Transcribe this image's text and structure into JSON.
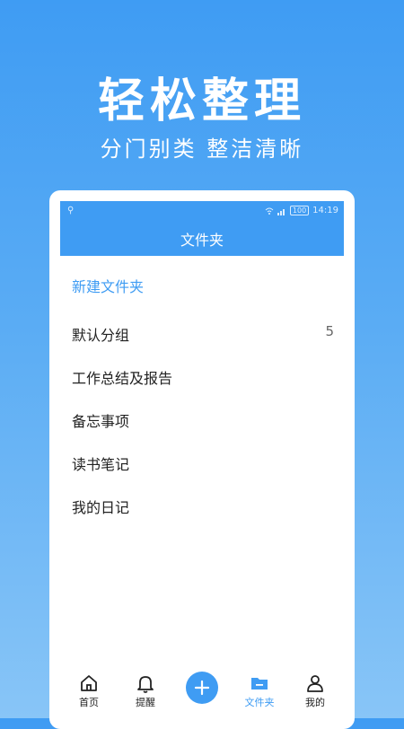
{
  "banner": {
    "headline": "轻松整理",
    "subline": "分门别类 整洁清晰"
  },
  "statusbar": {
    "battery": "100",
    "time": "14:19"
  },
  "header": {
    "title": "文件夹"
  },
  "new_folder_label": "新建文件夹",
  "folders": [
    {
      "name": "默认分组",
      "count": "5"
    },
    {
      "name": "工作总结及报告",
      "count": ""
    },
    {
      "name": "备忘事项",
      "count": ""
    },
    {
      "name": "读书笔记",
      "count": ""
    },
    {
      "name": "我的日记",
      "count": ""
    }
  ],
  "tabbar": {
    "items": [
      {
        "label": "首页",
        "icon": "home-icon"
      },
      {
        "label": "提醒",
        "icon": "bell-icon"
      },
      {
        "label": "",
        "icon": "plus-icon"
      },
      {
        "label": "文件夹",
        "icon": "folder-icon"
      },
      {
        "label": "我的",
        "icon": "user-icon"
      }
    ],
    "active_index": 3
  },
  "colors": {
    "accent": "#3f9cf3",
    "background_top": "#3f9cf3",
    "background_bottom": "#88c5f7"
  }
}
